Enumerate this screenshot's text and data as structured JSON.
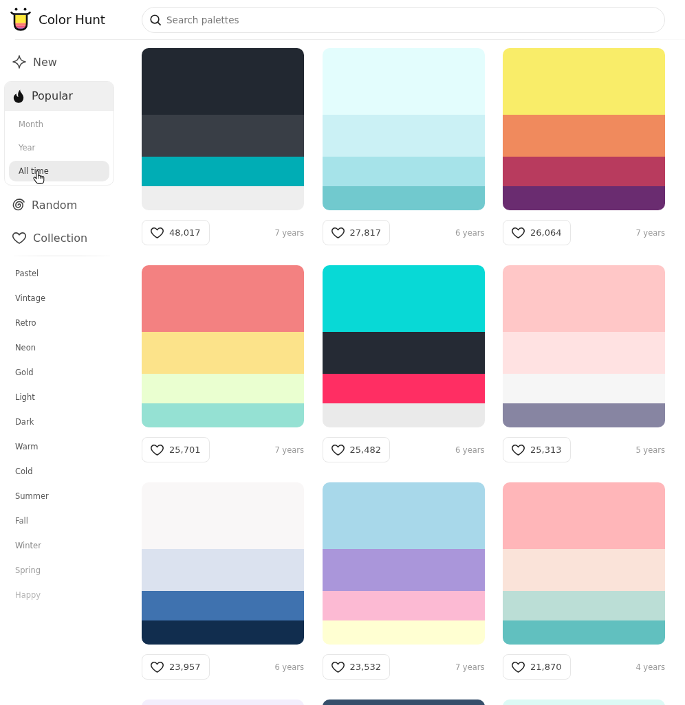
{
  "header": {
    "site_title": "Color Hunt",
    "search": {
      "placeholder": "Search palettes"
    }
  },
  "sidebar": {
    "nav": [
      {
        "label": "New",
        "selected": false
      },
      {
        "label": "Popular",
        "selected": true,
        "expanded": true,
        "children": [
          {
            "label": "Month",
            "selected": false
          },
          {
            "label": "Year",
            "selected": false
          },
          {
            "label": "All time",
            "selected": true
          }
        ]
      },
      {
        "label": "Random",
        "selected": false
      },
      {
        "label": "Collection",
        "selected": false
      }
    ],
    "tags": [
      "Pastel",
      "Vintage",
      "Retro",
      "Neon",
      "Gold",
      "Light",
      "Dark",
      "Warm",
      "Cold",
      "Summer",
      "Fall",
      "Winter",
      "Spring",
      "Happy"
    ]
  },
  "palettes": [
    {
      "swatches": [
        {
          "color": "#222831"
        },
        {
          "color": "#393e46"
        },
        {
          "color": "#00adb5"
        },
        {
          "color": "#eeeeee"
        }
      ],
      "likes": "48,017",
      "age": "7 years"
    },
    {
      "swatches": [
        {
          "color": "#e3fdfd"
        },
        {
          "color": "#cbf1f5"
        },
        {
          "color": "#a6e3e9"
        },
        {
          "color": "#71c9ce"
        }
      ],
      "likes": "27,817",
      "age": "6 years"
    },
    {
      "swatches": [
        {
          "color": "#f9ed69"
        },
        {
          "color": "#f08a5d"
        },
        {
          "color": "#b83b5e"
        },
        {
          "color": "#6a2c70"
        }
      ],
      "likes": "26,064",
      "age": "7 years"
    },
    {
      "swatches": [
        {
          "color": "#f38181"
        },
        {
          "color": "#fce38a"
        },
        {
          "color": "#eaffd0"
        },
        {
          "color": "#95e1d3"
        }
      ],
      "likes": "25,701",
      "age": "7 years"
    },
    {
      "swatches": [
        {
          "color": "#08d9d6"
        },
        {
          "color": "#252a34"
        },
        {
          "color": "#ff2e63"
        },
        {
          "color": "#eaeaea"
        }
      ],
      "likes": "25,482",
      "age": "6 years"
    },
    {
      "swatches": [
        {
          "color": "#ffc7c7"
        },
        {
          "color": "#ffe2e2"
        },
        {
          "color": "#f6f6f6"
        },
        {
          "color": "#8785a2"
        }
      ],
      "likes": "25,313",
      "age": "5 years"
    },
    {
      "swatches": [
        {
          "color": "#f9f7f7"
        },
        {
          "color": "#dbe2ef"
        },
        {
          "color": "#3f72af"
        },
        {
          "color": "#112d4e"
        }
      ],
      "likes": "23,957",
      "age": "6 years"
    },
    {
      "swatches": [
        {
          "color": "#a8d8ea"
        },
        {
          "color": "#aa96da"
        },
        {
          "color": "#fcbad3"
        },
        {
          "color": "#ffffd2"
        }
      ],
      "likes": "23,532",
      "age": "7 years"
    },
    {
      "swatches": [
        {
          "color": "#ffb6b9"
        },
        {
          "color": "#fae3d9"
        },
        {
          "color": "#bbded6"
        },
        {
          "color": "#61c0bf"
        }
      ],
      "likes": "21,870",
      "age": "4 years"
    },
    {
      "swatches": [
        {
          "color": "#f3eefc"
        }
      ]
    },
    {
      "swatches": [
        {
          "color": "#364f6b"
        }
      ]
    },
    {
      "swatches": [
        {
          "color": "#dcfaf5"
        }
      ]
    }
  ]
}
